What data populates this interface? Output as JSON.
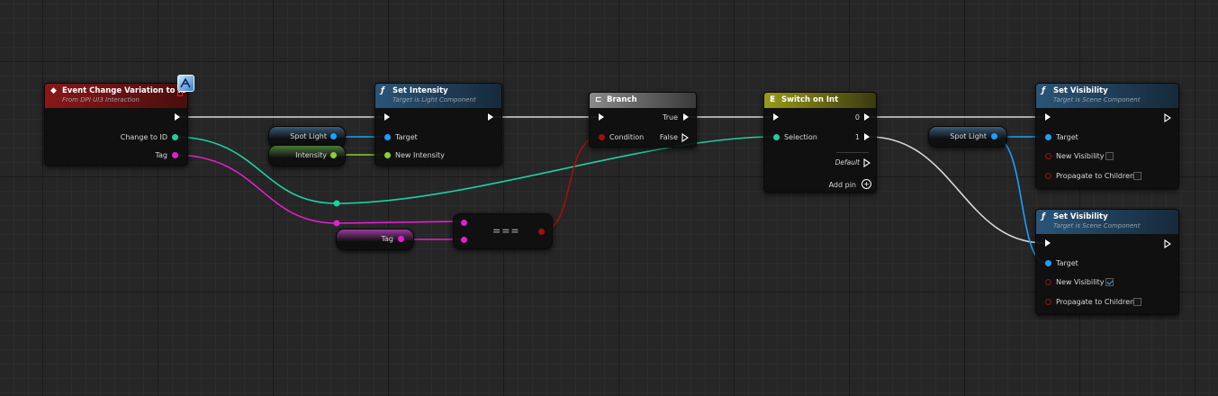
{
  "nodes": {
    "event_change_variation": {
      "title": "Event Change Variation to ID",
      "subtitle": "From DPI UI3 Interaction",
      "pins": {
        "change_to_id": "Change to ID",
        "tag": "Tag"
      }
    },
    "set_intensity": {
      "title": "Set Intensity",
      "subtitle": "Target is Light Component",
      "pins": {
        "target": "Target",
        "new_intensity": "New Intensity"
      }
    },
    "branch": {
      "title": "Branch",
      "pins": {
        "condition": "Condition",
        "true": "True",
        "false": "False"
      }
    },
    "switch_on_int": {
      "title": "Switch on Int",
      "pins": {
        "selection": "Selection",
        "out0": "0",
        "out1": "1",
        "default": "Default",
        "add_pin": "Add pin"
      }
    },
    "set_visibility_1": {
      "title": "Set Visibility",
      "subtitle": "Target is Scene Component",
      "pins": {
        "target": "Target",
        "new_visibility": "New Visibility",
        "propagate": "Propagate to Children"
      },
      "new_visibility_checked": false,
      "propagate_checked": false
    },
    "set_visibility_2": {
      "title": "Set Visibility",
      "subtitle": "Target is Scene Component",
      "pins": {
        "target": "Target",
        "new_visibility": "New Visibility",
        "propagate": "Propagate to Children"
      },
      "new_visibility_checked": true,
      "propagate_checked": false
    },
    "equal_op": {
      "label": "==="
    }
  },
  "variables": {
    "spot_light_1": "Spot Light",
    "intensity": "Intensity",
    "tag": "Tag",
    "spot_light_2": "Spot Light"
  },
  "colors": {
    "exec": "#ffffff",
    "object": "#1aa0ff",
    "int": "#1ecfa0",
    "name": "#e020d0",
    "float": "#8ad030",
    "bool": "#a01010",
    "event_header": "#7a1414",
    "function_header": "#2a5578",
    "branch_header": "#8a8a8a",
    "switch_header": "#8a8a14"
  }
}
